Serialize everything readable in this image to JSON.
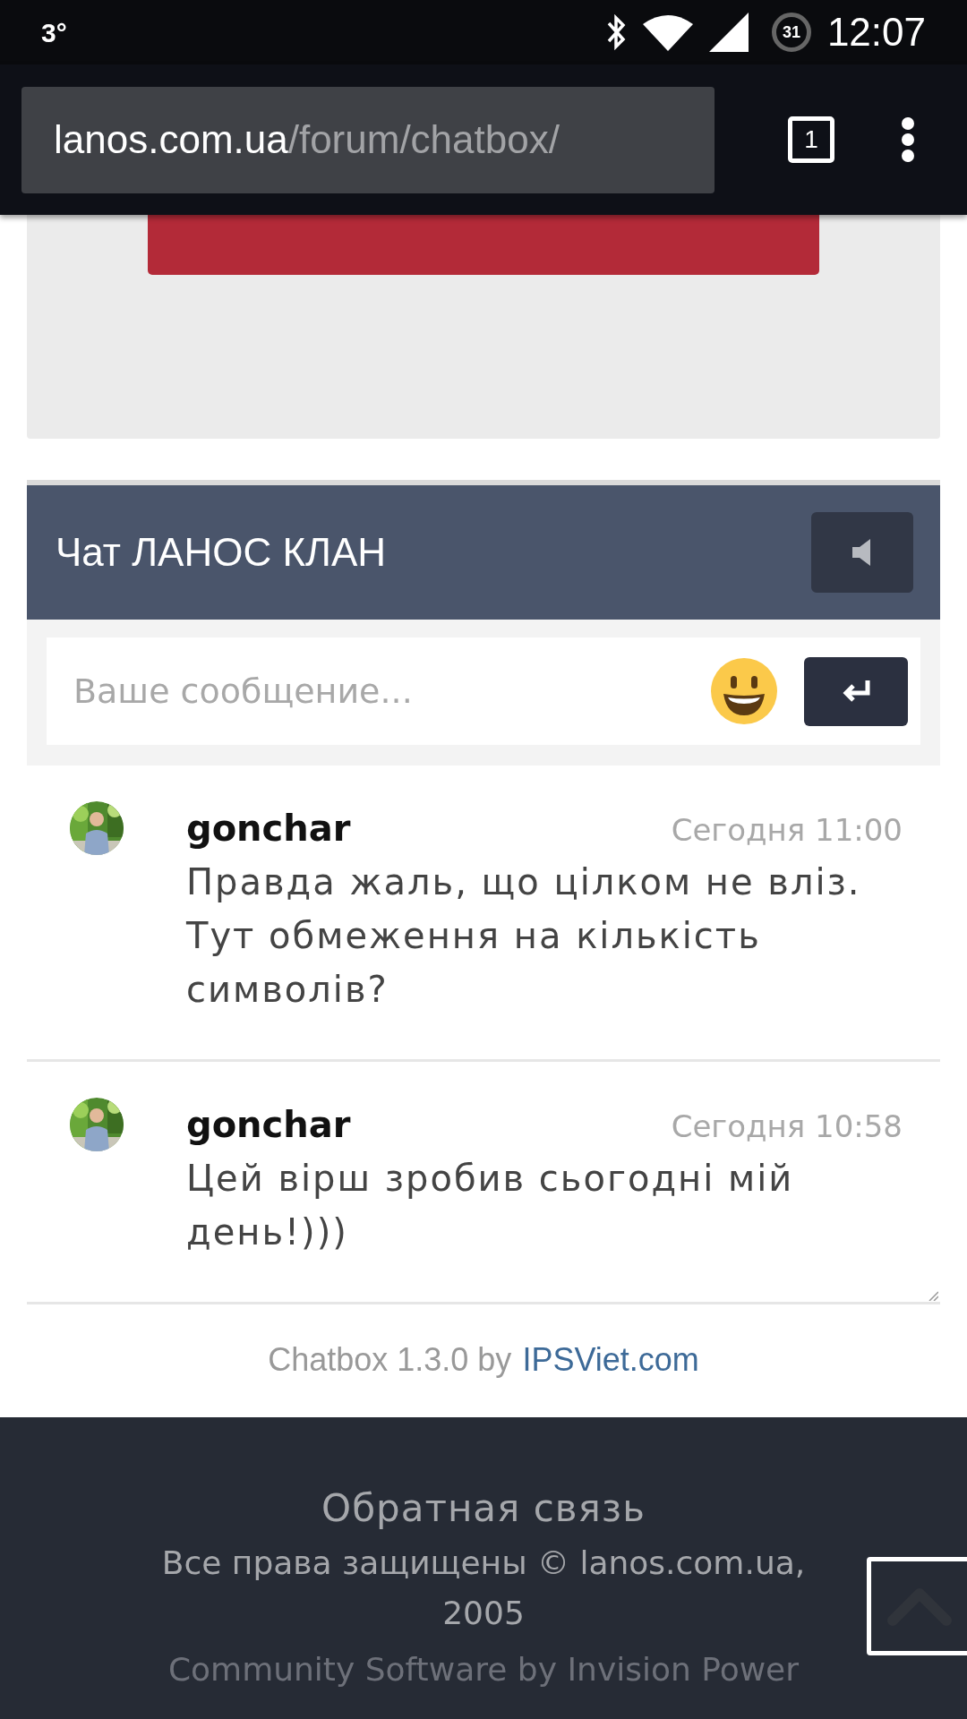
{
  "status_bar": {
    "weather": "3°",
    "battery": "31",
    "time": "12:07"
  },
  "browser": {
    "url_host": "lanos.com.ua",
    "url_path": "/forum/chatbox/",
    "tab_count": "1"
  },
  "chatbox": {
    "title": "Чат ЛАНОС КЛАН",
    "input": {
      "placeholder": "Ваше сообщение..."
    },
    "messages": [
      {
        "author": "gonchar",
        "time": "Сегодня 11:00",
        "text": "Правда жаль, що цілком не вліз. Тут обмеження на кількість символів?"
      },
      {
        "author": "gonchar",
        "time": "Сегодня 10:58",
        "text": "Цей вірш зробив сьогодні мій день!)))"
      }
    ],
    "credit": {
      "text": "Chatbox 1.3.0 by",
      "link": "IPSViet.com"
    }
  },
  "footer": {
    "feedback": "Обратная связь",
    "copyright": "Все права защищены © lanos.com.ua, 2005",
    "powered": "Community Software by Invision Power"
  }
}
